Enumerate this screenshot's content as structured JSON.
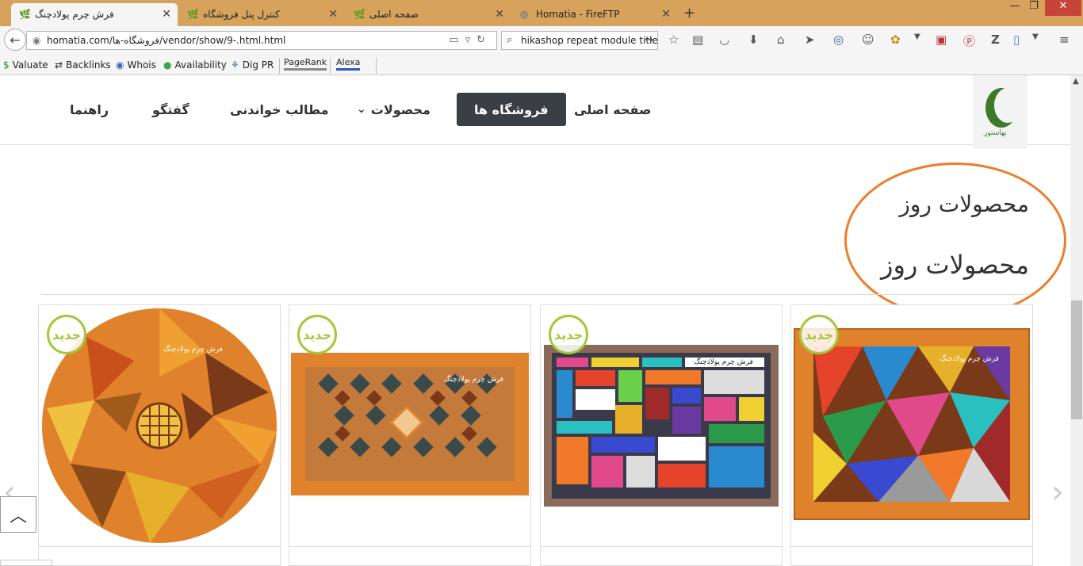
{
  "tabs": [
    {
      "title": "فرش چرم پولادچنگ",
      "active": true,
      "rtl": true
    },
    {
      "title": "کنترل پنل فروشگاه",
      "active": false,
      "rtl": true
    },
    {
      "title": "صفحه اصلی",
      "active": false,
      "rtl": true
    },
    {
      "title": "Homatia - FireFTP",
      "active": false,
      "rtl": false
    }
  ],
  "newtab_label": "+",
  "window_controls": {
    "minimize": "—",
    "restore": "❐",
    "close": "✕"
  },
  "url": "homatia.com/فروشگاه-ها/vendor/show/9-.html.html",
  "search": {
    "value": "hikashop repeat module title"
  },
  "bookmarks": [
    {
      "label": "Valuate",
      "icon": "$"
    },
    {
      "label": "Backlinks",
      "icon": "⇄"
    },
    {
      "label": "Whois",
      "icon": "◉"
    },
    {
      "label": "Availability",
      "icon": "●"
    },
    {
      "label": "Dig PR",
      "icon": "⚘"
    }
  ],
  "pagerank_label": "PageRank",
  "alexa_label": "Alexa",
  "menu": {
    "home": "صفحه اصلی",
    "stores": "فروشگاه ها",
    "products": "محصولات",
    "articles": "مطالب خواندنی",
    "chat": "گفتگو",
    "help": "راهنما"
  },
  "logo_text": "بهاستور",
  "section_title_1": "محصولات روز",
  "section_title_2": "محصولات روز",
  "new_badge": "جدید",
  "watermark": "فرش چرم پولادچنگ",
  "colors": {
    "active_menu": "#3a3e45",
    "badge": "#a4c83a",
    "oval": "#ec7d2c",
    "titlebar": "#d7a35c"
  }
}
